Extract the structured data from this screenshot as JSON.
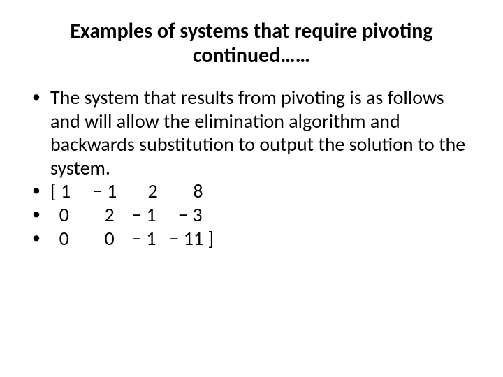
{
  "slide": {
    "title": "Examples of systems that require pivoting continued……",
    "bullets": [
      "The system that results from pivoting is as follows and will allow the elimination algorithm and backwards substitution to output the solution to the system.",
      "[ 1     − 1       2        8",
      "  0        2    − 1     − 3",
      "  0        0    − 1   − 11 ]"
    ]
  }
}
